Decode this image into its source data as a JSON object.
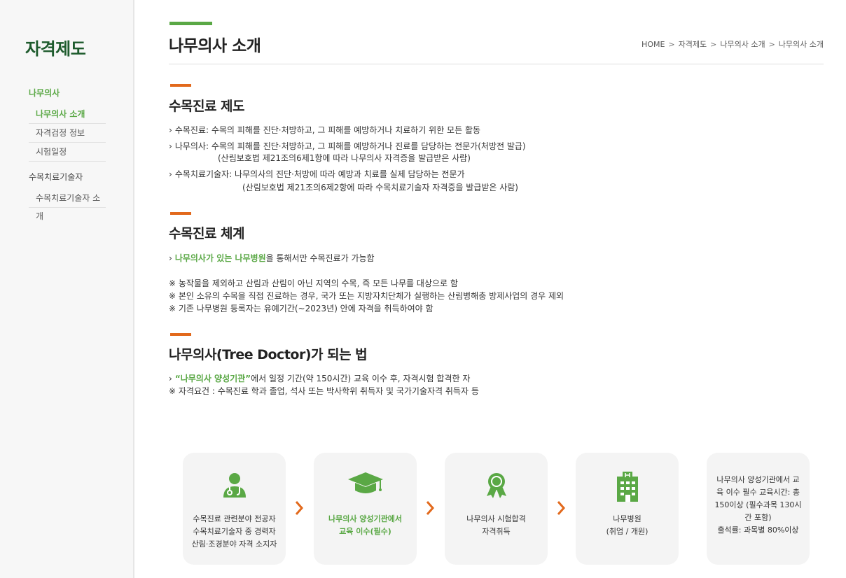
{
  "sidebar": {
    "title": "자격제도",
    "cat1": "나무의사",
    "cat1_items": [
      "나무의사 소개",
      "자격검정 정보",
      "시험일정"
    ],
    "cat2": "수목치료기술자",
    "cat2_items": [
      "수목치료기술자 소개"
    ]
  },
  "header": {
    "title": "나무의사 소개",
    "breadcrumb": [
      "HOME",
      "자격제도",
      "나무의사 소개",
      "나무의사 소개"
    ]
  },
  "section1": {
    "title": "수목진료 제도",
    "l1": "수목진료: 수목의 피해를 진단·처방하고, 그 피해를 예방하거나 치료하기 위한 모든 활동",
    "l2": "나무의사: 수목의 피해를 진단·처방하고, 그 피해를 예방하거나 진료를 담당하는 전문가(처방전 발급)",
    "l2b": "(산림보호법 제21조의6제1항에 따라 나무의사 자격증을 발급받은 사람)",
    "l3": "수목치료기술자: 나무의사의 진단·처방에 따라 예방과 치료를 실제 담당하는 전문가",
    "l3b": "(산림보호법 제21조의6제2항에 따라 수목치료기술자 자격증을 발급받은 사람)"
  },
  "section2": {
    "title": "수목진료 체계",
    "hl": "나무의사가 있는 나무병원",
    "rest": "을 통해서만 수목진료가 가능함",
    "n1": "※ 농작물을 제외하고 산림과 산림이 아닌 지역의 수목, 즉 모든 나무를 대상으로 함",
    "n2": "※ 본인 소유의 수목을 직접 진료하는 경우, 국가 또는 지방자치단체가 실행하는 산림병해충 방제사업의 경우 제외",
    "n3": "※ 기존 나무병원 등록자는 유예기간(~2023년) 안에 자격을 취득하여야 함"
  },
  "section3": {
    "title": "나무의사(Tree Doctor)가 되는 법",
    "hl": "“나무의사 양성기관”",
    "rest": "에서 일정 기간(약 150시간) 교육 이수 후, 자격시험 합격한 자",
    "n1": "※ 자격요건 : 수목진료 학과 졸업, 석사 또는 박사학위 취득자 및 국가기술자격 취득자 등"
  },
  "process": {
    "card1": [
      "수목진료 관련분야 전공자",
      "수목치료기술자 중 경력자",
      "산림·조경분야 자격 소지자"
    ],
    "card2": [
      "나무의사 양성기관에서",
      "교육 이수(필수)"
    ],
    "card3": [
      "나무의사 시험합격",
      "자격취득"
    ],
    "card4": [
      "나무병원",
      "(취업 / 개원)"
    ],
    "card5": [
      "나무의사 양성기관에서 교",
      "육 이수 필수 교육시간: 총",
      "150이상 (필수과목 130시",
      "간 포함)",
      "출석률: 과목별 80%이상"
    ]
  },
  "colors": {
    "green": "#5aa845",
    "orange": "#e2691c",
    "dark_green": "#1e5b2d"
  },
  "icons": [
    "doctor-icon",
    "graduation-cap-icon",
    "award-ribbon-icon",
    "hospital-building-icon",
    "chevron-right-icon"
  ]
}
